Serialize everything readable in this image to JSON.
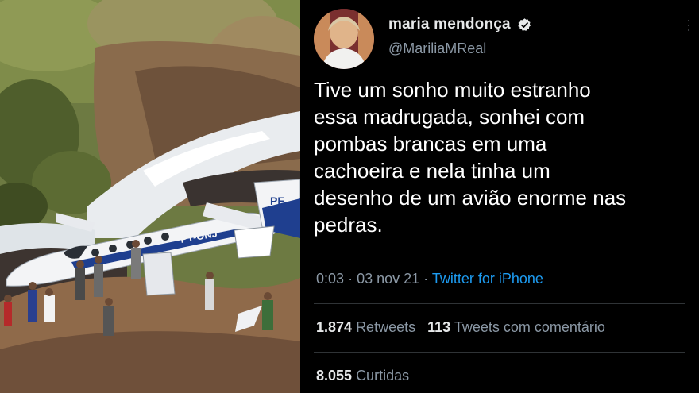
{
  "photo": {
    "icon": "plane-crash-waterfall-photo",
    "aircraft_tail_text": "PE",
    "aircraft_registration_text": "PT-ONJ"
  },
  "tweet": {
    "display_name": "maria mendonça",
    "handle": "@MariliaMReal",
    "verified_icon": "verified-badge-icon",
    "text_lines": [
      "Tive um sonho muito estranho",
      "essa madrugada, sonhei com",
      "pombas brancas em uma",
      "cachoeira e nela tinha um",
      "desenho de um avião enorme nas",
      "pedras."
    ],
    "time": "0:03",
    "date": "03 nov 21",
    "separator": "·",
    "source": "Twitter for iPhone",
    "retweets_count": "1.874",
    "retweets_label": "Retweets",
    "quotes_count": "113",
    "quotes_label": "Tweets com comentário",
    "likes_count": "8.055",
    "likes_label": "Curtidas"
  },
  "colors": {
    "background": "#000000",
    "text": "#ffffff",
    "secondary_text": "#8b98a5",
    "link": "#1d9bf0",
    "divider": "#2f3336"
  }
}
